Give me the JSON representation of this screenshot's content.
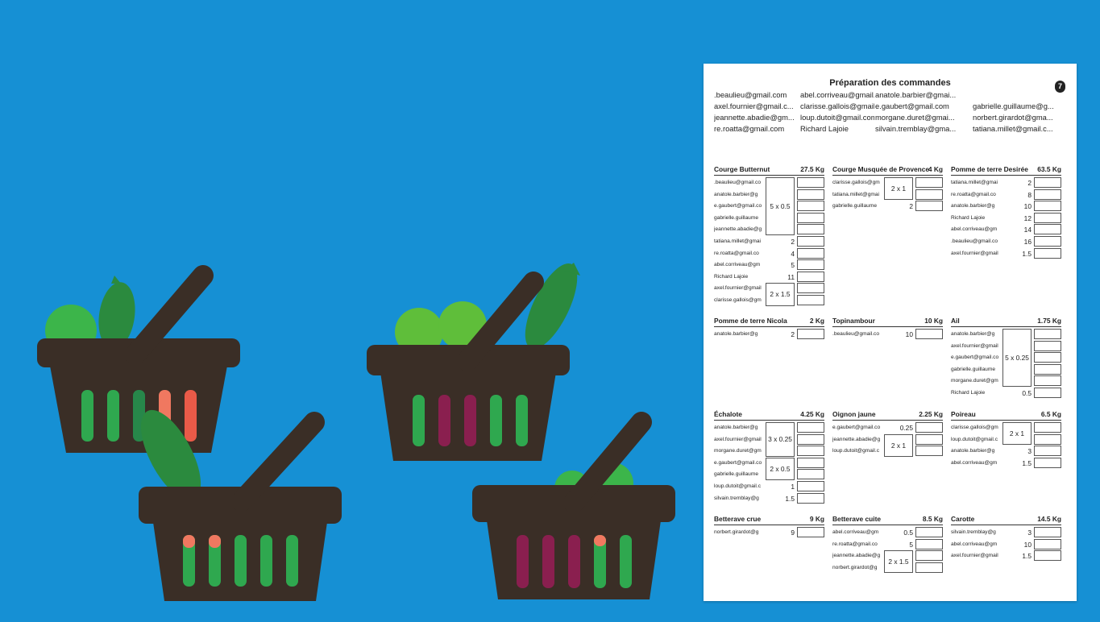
{
  "colors": {
    "background": "#1690d4",
    "basket": "#3a2e26",
    "sheet": "#ffffff"
  },
  "sheet": {
    "title": "Préparation des commandes",
    "page_number": "7",
    "customers": [
      ".beaulieu@gmail.com",
      "abel.corriveau@gmail....",
      "anatole.barbier@gmai...",
      "",
      "axel.fournier@gmail.c...",
      "clarisse.gallois@gmail...",
      "e.gaubert@gmail.com",
      "gabrielle.guillaume@g...",
      "jeannette.abadie@gm...",
      "loup.dutoit@gmail.com",
      "morgane.duret@gmai...",
      "norbert.girardot@gma...",
      "re.roatta@gmail.com",
      "Richard Lajoie",
      "silvain.tremblay@gma...",
      "tatiana.millet@gmail.c..."
    ]
  },
  "products": [
    {
      "name": "Courge Butternut",
      "weight": "27.5 Kg",
      "rows": [
        {
          "who": ".beaulieu@gmail.co",
          "qty": ""
        },
        {
          "who": "anatole.barbier@g",
          "qty": ""
        },
        {
          "who": "e.gaubert@gmail.co",
          "qty": ""
        },
        {
          "who": "gabrielle.guillaume",
          "qty": ""
        },
        {
          "who": "jeannette.abadie@g",
          "qty": ""
        },
        {
          "who": "tatiana.millet@gmai",
          "qty": "2"
        },
        {
          "who": "re.roatta@gmail.co",
          "qty": "4"
        },
        {
          "who": "abel.corriveau@gm",
          "qty": "5"
        },
        {
          "who": "Richard Lajoie",
          "qty": "11"
        },
        {
          "who": "axel.fournier@gmail",
          "qty": ""
        },
        {
          "who": "clarisse.gallois@gm",
          "qty": ""
        }
      ],
      "groups": [
        {
          "label": "5 x 0.5",
          "from": 0,
          "span": 5
        },
        {
          "label": "2 x 1.5",
          "from": 9,
          "span": 2
        }
      ]
    },
    {
      "name": "Courge Musquée de Provence",
      "weight": "4 Kg",
      "rows": [
        {
          "who": "clarisse.gallois@gm",
          "qty": ""
        },
        {
          "who": "tatiana.millet@gmai",
          "qty": ""
        },
        {
          "who": "gabrielle.guillaume",
          "qty": "2"
        }
      ],
      "groups": [
        {
          "label": "2 x 1",
          "from": 0,
          "span": 2
        }
      ]
    },
    {
      "name": "Pomme de terre Desirée",
      "weight": "63.5 Kg",
      "rows": [
        {
          "who": "tatiana.millet@gmai",
          "qty": "2"
        },
        {
          "who": "re.roatta@gmail.co",
          "qty": "8"
        },
        {
          "who": "anatole.barbier@g",
          "qty": "10"
        },
        {
          "who": "Richard Lajoie",
          "qty": "12"
        },
        {
          "who": "abel.corriveau@gm",
          "qty": "14"
        },
        {
          "who": ".beaulieu@gmail.co",
          "qty": "16"
        },
        {
          "who": "axel.fournier@gmail",
          "qty": "1.5"
        }
      ],
      "groups": []
    },
    {
      "name": "Pomme de terre Nicola",
      "weight": "2 Kg",
      "rows": [
        {
          "who": "anatole.barbier@g",
          "qty": "2"
        }
      ],
      "groups": []
    },
    {
      "name": "Topinambour",
      "weight": "10 Kg",
      "rows": [
        {
          "who": ".beaulieu@gmail.co",
          "qty": "10"
        }
      ],
      "groups": []
    },
    {
      "name": "Ail",
      "weight": "1.75 Kg",
      "rows": [
        {
          "who": "anatole.barbier@g",
          "qty": ""
        },
        {
          "who": "axel.fournier@gmail",
          "qty": ""
        },
        {
          "who": "e.gaubert@gmail.co",
          "qty": ""
        },
        {
          "who": "gabrielle.guillaume",
          "qty": ""
        },
        {
          "who": "morgane.duret@gm",
          "qty": ""
        },
        {
          "who": "Richard Lajoie",
          "qty": "0.5"
        }
      ],
      "groups": [
        {
          "label": "5 x 0.25",
          "from": 0,
          "span": 5
        }
      ]
    },
    {
      "name": "Échalote",
      "weight": "4.25 Kg",
      "rows": [
        {
          "who": "anatole.barbier@g",
          "qty": ""
        },
        {
          "who": "axel.fournier@gmail",
          "qty": ""
        },
        {
          "who": "morgane.duret@gm",
          "qty": ""
        },
        {
          "who": "e.gaubert@gmail.co",
          "qty": ""
        },
        {
          "who": "gabrielle.guillaume",
          "qty": ""
        },
        {
          "who": "loup.dutoit@gmail.c",
          "qty": "1"
        },
        {
          "who": "silvain.tremblay@g",
          "qty": "1.5"
        }
      ],
      "groups": [
        {
          "label": "3 x 0.25",
          "from": 0,
          "span": 3
        },
        {
          "label": "2 x 0.5",
          "from": 3,
          "span": 2
        }
      ]
    },
    {
      "name": "Oignon jaune",
      "weight": "2.25 Kg",
      "rows": [
        {
          "who": "e.gaubert@gmail.co",
          "qty": "0.25"
        },
        {
          "who": "jeannette.abadie@g",
          "qty": ""
        },
        {
          "who": "loup.dutoit@gmail.c",
          "qty": ""
        }
      ],
      "groups": [
        {
          "label": "2 x 1",
          "from": 1,
          "span": 2
        }
      ]
    },
    {
      "name": "Poireau",
      "weight": "6.5 Kg",
      "rows": [
        {
          "who": "clarisse.gallois@gm",
          "qty": ""
        },
        {
          "who": "loup.dutoit@gmail.c",
          "qty": ""
        },
        {
          "who": "anatole.barbier@g",
          "qty": "3"
        },
        {
          "who": "abel.corriveau@gm",
          "qty": "1.5"
        }
      ],
      "groups": [
        {
          "label": "2 x 1",
          "from": 0,
          "span": 2
        }
      ]
    },
    {
      "name": "Betterave crue",
      "weight": "9 Kg",
      "rows": [
        {
          "who": "norbert.girardot@g",
          "qty": "9"
        }
      ],
      "groups": []
    },
    {
      "name": "Betterave cuite",
      "weight": "8.5 Kg",
      "rows": [
        {
          "who": "abel.corriveau@gm",
          "qty": "0.5"
        },
        {
          "who": "re.roatta@gmail.co",
          "qty": "5"
        },
        {
          "who": "jeannette.abadie@g",
          "qty": ""
        },
        {
          "who": "norbert.girardot@g",
          "qty": ""
        }
      ],
      "groups": [
        {
          "label": "2 x 1.5",
          "from": 2,
          "span": 2
        }
      ]
    },
    {
      "name": "Carotte",
      "weight": "14.5 Kg",
      "rows": [
        {
          "who": "silvain.tremblay@g",
          "qty": "3"
        },
        {
          "who": "abel.corriveau@gm",
          "qty": "10"
        },
        {
          "who": "axel.fournier@gmail",
          "qty": "1.5"
        }
      ],
      "groups": []
    }
  ]
}
